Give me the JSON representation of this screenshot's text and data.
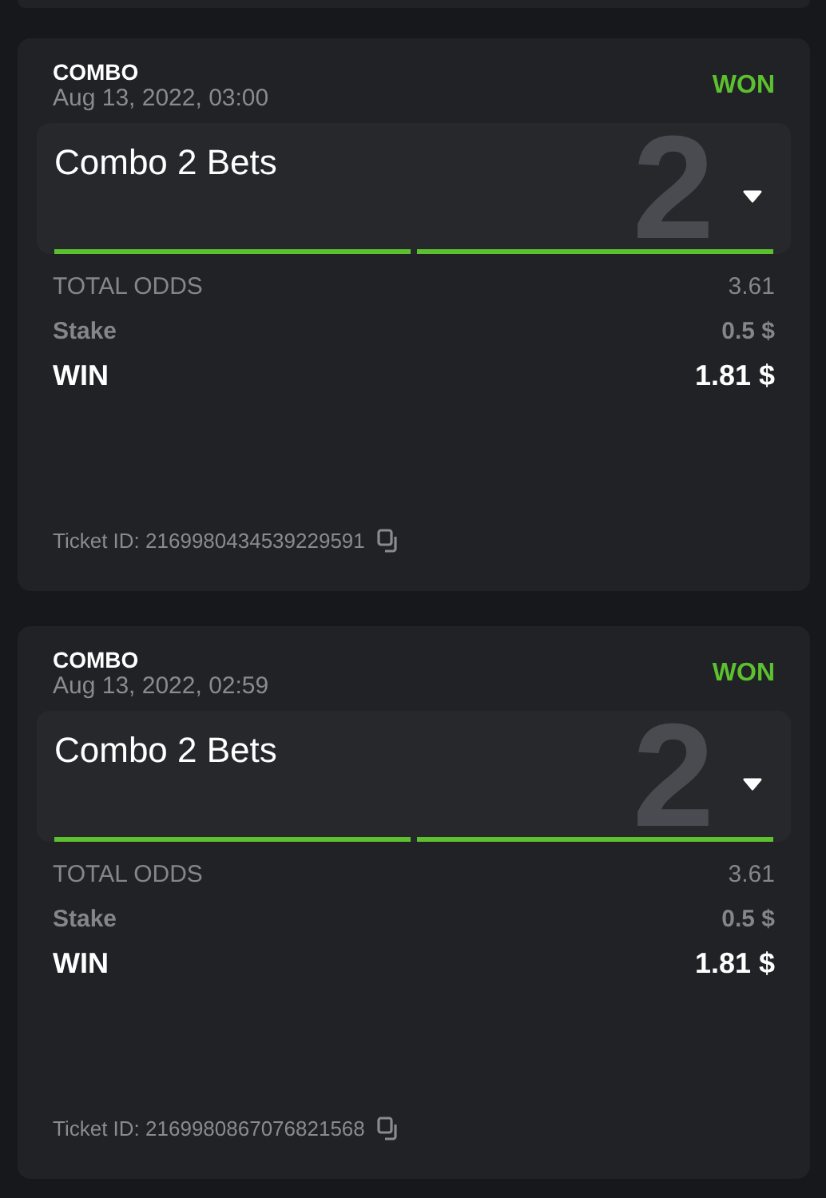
{
  "tickets": [
    {
      "type": "COMBO",
      "date": "Aug 13, 2022, 03:00",
      "status": "WON",
      "title": "Combo 2 Bets",
      "count": "2",
      "legs": [
        {
          "color": "#5cc02f"
        },
        {
          "color": "#5cc02f"
        }
      ],
      "total_odds_label": "TOTAL ODDS",
      "total_odds": "3.61",
      "stake_label": "Stake",
      "stake": "0.5 $",
      "win_label": "WIN",
      "win": "1.81 $",
      "ticket_id": "Ticket ID: 2169980434539229591"
    },
    {
      "type": "COMBO",
      "date": "Aug 13, 2022, 02:59",
      "status": "WON",
      "title": "Combo 2 Bets",
      "count": "2",
      "legs": [
        {
          "color": "#5cc02f"
        },
        {
          "color": "#5cc02f"
        }
      ],
      "total_odds_label": "TOTAL ODDS",
      "total_odds": "3.61",
      "stake_label": "Stake",
      "stake": "0.5 $",
      "win_label": "WIN",
      "win": "1.81 $",
      "ticket_id": "Ticket ID: 2169980867076821568"
    }
  ]
}
